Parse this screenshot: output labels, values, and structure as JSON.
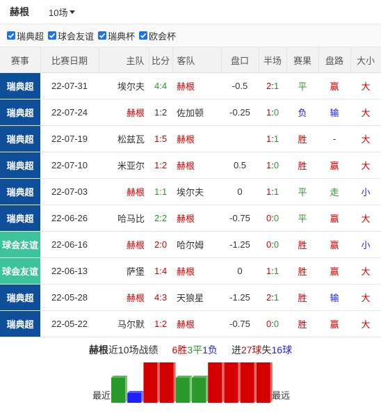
{
  "header": {
    "team": "赫根",
    "count_label": "10场"
  },
  "filters": [
    {
      "label": "瑞典超",
      "checked": true
    },
    {
      "label": "球会友谊",
      "checked": true
    },
    {
      "label": "瑞典杯",
      "checked": true
    },
    {
      "label": "欧会杯",
      "checked": true
    }
  ],
  "columns": [
    "赛事",
    "比赛日期",
    "主队",
    "比分",
    "客队",
    "盘口",
    "半场",
    "赛果",
    "盘路",
    "大小"
  ],
  "colors": {
    "league_super": "#0f4f9a",
    "league_friendly": "#3dc39a",
    "win": "#d40000",
    "draw": "#2a9a2a",
    "loss": "#1e20ff"
  },
  "matches": [
    {
      "league": "瑞典超",
      "league_type": "super",
      "date": "22-07-31",
      "home": "埃尔夫",
      "home_red": false,
      "score_h": "4",
      "score_sep": ":",
      "score_a": "4",
      "score_color": "green",
      "away": "赫根",
      "away_red": true,
      "line": "-0.5",
      "half_h": "2",
      "half_a": "1",
      "result": "平",
      "result_color": "green",
      "handicap": "赢",
      "handicap_color": "red",
      "ou": "大",
      "ou_color": "red"
    },
    {
      "league": "瑞典超",
      "league_type": "super",
      "date": "22-07-24",
      "home": "赫根",
      "home_red": true,
      "score_h": "1",
      "score_sep": ":",
      "score_a": "2",
      "score_color": "dark",
      "away": "佐加顿",
      "away_red": false,
      "line": "-0.25",
      "half_h": "1",
      "half_a": "0",
      "result": "负",
      "result_color": "blue",
      "handicap": "输",
      "handicap_color": "blue",
      "ou": "大",
      "ou_color": "red"
    },
    {
      "league": "瑞典超",
      "league_type": "super",
      "date": "22-07-19",
      "home": "松兹瓦",
      "home_red": false,
      "score_h": "1",
      "score_sep": ":",
      "score_a": "5",
      "score_color": "red",
      "away": "赫根",
      "away_red": true,
      "line": "",
      "half_h": "1",
      "half_a": "1",
      "result": "胜",
      "result_color": "red",
      "handicap": "-",
      "handicap_color": "dark",
      "ou": "大",
      "ou_color": "red"
    },
    {
      "league": "瑞典超",
      "league_type": "super",
      "date": "22-07-10",
      "home": "米亚尔",
      "home_red": false,
      "score_h": "1",
      "score_sep": ":",
      "score_a": "2",
      "score_color": "red",
      "away": "赫根",
      "away_red": true,
      "line": "0.5",
      "half_h": "1",
      "half_a": "0",
      "result": "胜",
      "result_color": "red",
      "handicap": "赢",
      "handicap_color": "red",
      "ou": "大",
      "ou_color": "red"
    },
    {
      "league": "瑞典超",
      "league_type": "super",
      "date": "22-07-03",
      "home": "赫根",
      "home_red": true,
      "score_h": "1",
      "score_sep": ":",
      "score_a": "1",
      "score_color": "green",
      "away": "埃尔夫",
      "away_red": false,
      "line": "0",
      "half_h": "1",
      "half_a": "1",
      "result": "平",
      "result_color": "green",
      "handicap": "走",
      "handicap_color": "green",
      "ou": "小",
      "ou_color": "blue"
    },
    {
      "league": "瑞典超",
      "league_type": "super",
      "date": "22-06-26",
      "home": "哈马比",
      "home_red": false,
      "score_h": "2",
      "score_sep": ":",
      "score_a": "2",
      "score_color": "green",
      "away": "赫根",
      "away_red": true,
      "line": "-0.75",
      "half_h": "0",
      "half_a": "0",
      "result": "平",
      "result_color": "green",
      "handicap": "赢",
      "handicap_color": "red",
      "ou": "大",
      "ou_color": "red"
    },
    {
      "league": "球会友谊",
      "league_type": "friendly",
      "date": "22-06-16",
      "home": "赫根",
      "home_red": true,
      "score_h": "2",
      "score_sep": ":",
      "score_a": "0",
      "score_color": "red",
      "away": "哈尔姆",
      "away_red": false,
      "line": "-1.25",
      "half_h": "0",
      "half_a": "0",
      "result": "胜",
      "result_color": "red",
      "handicap": "赢",
      "handicap_color": "red",
      "ou": "小",
      "ou_color": "blue"
    },
    {
      "league": "球会友谊",
      "league_type": "friendly",
      "date": "22-06-13",
      "home": "萨堡",
      "home_red": false,
      "score_h": "1",
      "score_sep": ":",
      "score_a": "4",
      "score_color": "red",
      "away": "赫根",
      "away_red": true,
      "line": "0",
      "half_h": "1",
      "half_a": "1",
      "result": "胜",
      "result_color": "red",
      "handicap": "赢",
      "handicap_color": "red",
      "ou": "大",
      "ou_color": "red"
    },
    {
      "league": "瑞典超",
      "league_type": "super",
      "date": "22-05-28",
      "home": "赫根",
      "home_red": true,
      "score_h": "4",
      "score_sep": ":",
      "score_a": "3",
      "score_color": "red",
      "away": "天狼星",
      "away_red": false,
      "line": "-1.25",
      "half_h": "2",
      "half_a": "1",
      "result": "胜",
      "result_color": "red",
      "handicap": "输",
      "handicap_color": "blue",
      "ou": "大",
      "ou_color": "red"
    },
    {
      "league": "瑞典超",
      "league_type": "super",
      "date": "22-05-22",
      "home": "马尔默",
      "home_red": false,
      "score_h": "1",
      "score_sep": ":",
      "score_a": "2",
      "score_color": "red",
      "away": "赫根",
      "away_red": true,
      "line": "-0.75",
      "half_h": "0",
      "half_a": "0",
      "result": "胜",
      "result_color": "red",
      "handicap": "赢",
      "handicap_color": "red",
      "ou": "大",
      "ou_color": "red"
    }
  ],
  "summary": {
    "team": "赫根",
    "prefix": "近10场战绩",
    "wins": "6",
    "win_label": "胜",
    "draws": "3",
    "draw_label": "平",
    "losses": "1",
    "loss_label": "负",
    "scored_label": "进",
    "scored": "27",
    "ball_label": "球",
    "conceded_label": "失",
    "conceded": "16",
    "ball_label2": "球"
  },
  "form_chart": {
    "left_label": "最近",
    "right_label": "最远",
    "results": [
      "平",
      "负",
      "胜",
      "胜",
      "平",
      "平",
      "胜",
      "胜",
      "胜",
      "胜"
    ]
  }
}
